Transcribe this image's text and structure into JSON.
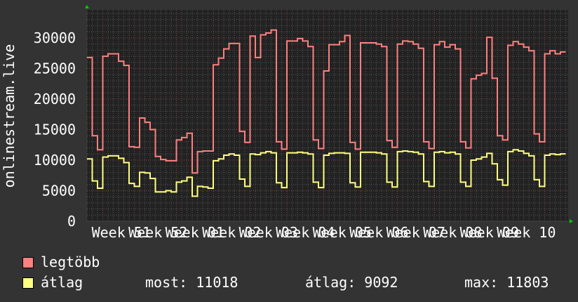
{
  "chart_data": {
    "type": "line",
    "ylabel": "onlinestream.live",
    "ylim": [
      0,
      34600
    ],
    "yticks": [
      "0",
      "5000",
      "10000",
      "15000",
      "20000",
      "25000",
      "30000"
    ],
    "x_tick_labels": [
      "Week 51",
      "Week 52",
      "Week 01",
      "Week 02",
      "Week 03",
      "Week 04",
      "Week 05",
      "Week 06",
      "Week 07",
      "Week 08",
      "Week 09",
      "Week 10"
    ],
    "grid": true,
    "series": [
      {
        "name": "legtöbb",
        "color": "#ff8080",
        "values": [
          26800,
          14000,
          11700,
          27000,
          27400,
          27400,
          26200,
          25500,
          12200,
          12100,
          16900,
          16200,
          15000,
          10600,
          10100,
          9900,
          9900,
          13300,
          13700,
          14400,
          7900,
          11400,
          11500,
          11500,
          25600,
          26700,
          28200,
          29100,
          29100,
          14700,
          12900,
          30300,
          26800,
          30500,
          30800,
          31300,
          13000,
          11800,
          29500,
          29500,
          29900,
          29500,
          28600,
          13300,
          11900,
          24600,
          28900,
          28900,
          29400,
          30400,
          12900,
          11800,
          29200,
          29200,
          29200,
          29000,
          28600,
          13200,
          12100,
          29000,
          29500,
          29400,
          29000,
          28300,
          13000,
          11900,
          28900,
          29400,
          28500,
          28900,
          28200,
          13000,
          12000,
          23300,
          23900,
          24200,
          30100,
          23400,
          14000,
          13300,
          28800,
          29400,
          29000,
          28500,
          27900,
          14300,
          13000,
          27400,
          27900,
          27400,
          27700
        ]
      },
      {
        "name": "átlag",
        "color": "#ffff80",
        "values": [
          10200,
          6600,
          5400,
          10500,
          10700,
          10700,
          10300,
          9600,
          6200,
          5700,
          8000,
          7900,
          7000,
          4800,
          4800,
          5000,
          4800,
          6400,
          6600,
          7200,
          4100,
          5700,
          5600,
          5400,
          9900,
          10200,
          10800,
          11000,
          10800,
          6900,
          5700,
          11000,
          10900,
          11200,
          11400,
          11200,
          6300,
          5500,
          11200,
          11200,
          11300,
          11200,
          11000,
          6400,
          5500,
          10800,
          11100,
          11200,
          11200,
          11100,
          6300,
          5600,
          11300,
          11300,
          11300,
          11200,
          11000,
          6400,
          5600,
          11400,
          11500,
          11400,
          11300,
          11000,
          6500,
          5700,
          11300,
          11400,
          11200,
          11300,
          11000,
          6400,
          5700,
          10000,
          10200,
          10500,
          11100,
          9400,
          6800,
          5900,
          11400,
          11700,
          11500,
          11100,
          10700,
          6800,
          5700,
          10800,
          11000,
          10900,
          11018
        ]
      }
    ]
  },
  "legend": {
    "max_label": "legtöbb",
    "avg_label": "átlag",
    "current": "most: 11018",
    "average": "átlag: 9092",
    "maximum": "max: 11803"
  },
  "colors": {
    "background": "#333333",
    "plot": "#222222",
    "grid_major": "#884444",
    "grid_minor": "#555555",
    "axis_arrow": "#00cc00"
  }
}
